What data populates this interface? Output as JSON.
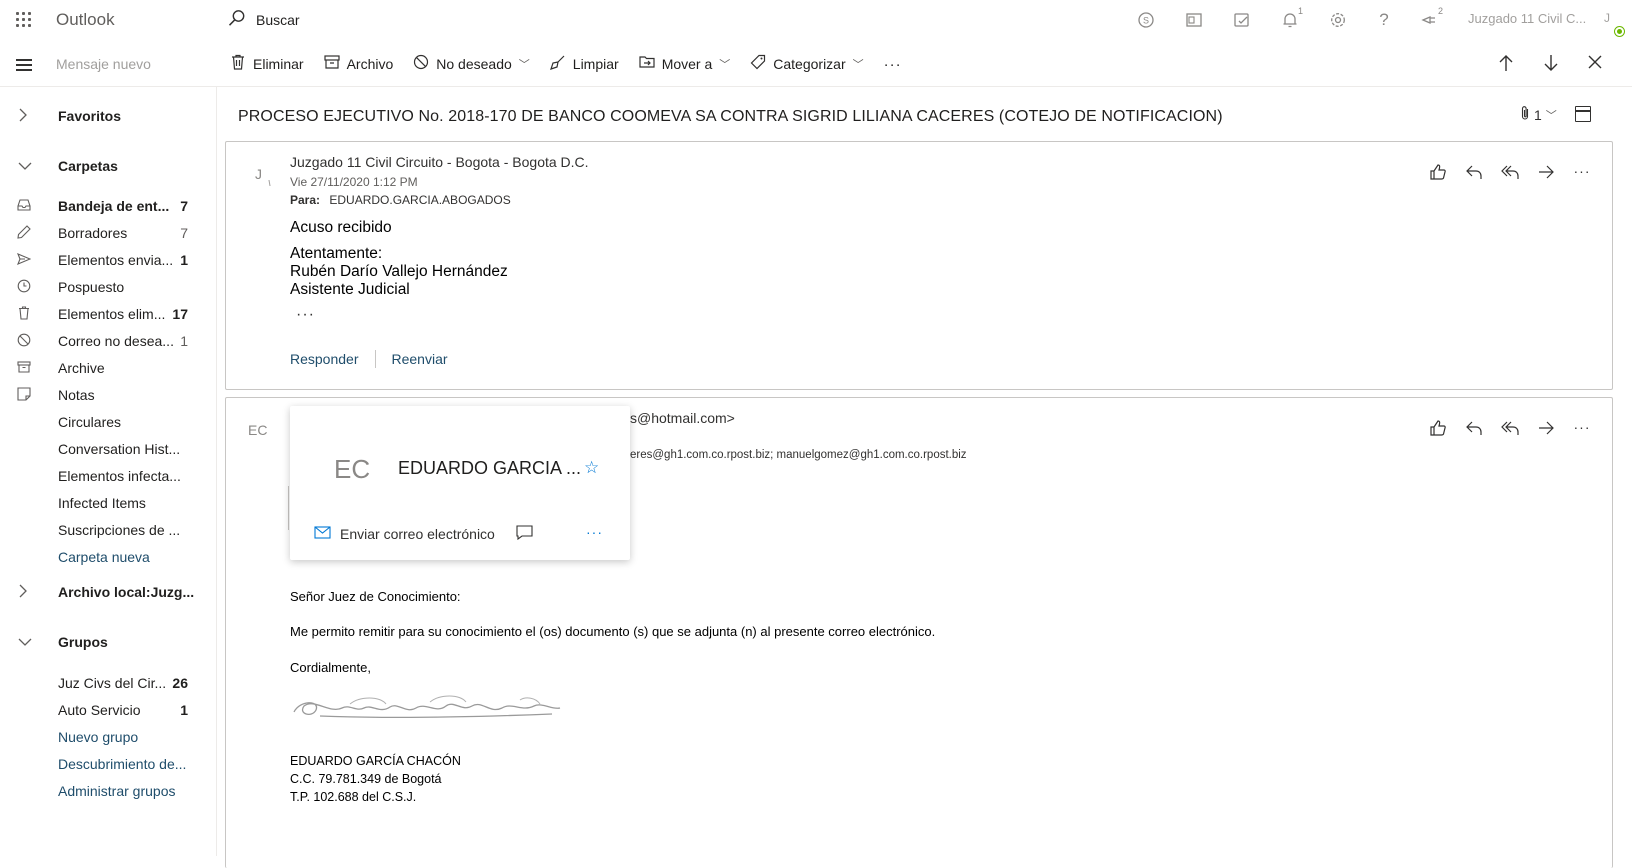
{
  "topbar": {
    "app_name": "Outlook",
    "search_text": "Buscar",
    "account_name": "Juzgado 11 Civil C...",
    "account_initial": "J",
    "notif_count_1": "1",
    "notif_count_2": "2",
    "icons": [
      "skype-icon",
      "office-icon",
      "tasks-icon",
      "bell-icon",
      "gear-icon",
      "help-icon",
      "feedback-icon"
    ]
  },
  "cmdbar": {
    "new_message": "Mensaje nuevo",
    "delete": "Eliminar",
    "archive": "Archivo",
    "junk": "No deseado",
    "sweep": "Limpiar",
    "move_to": "Mover a",
    "categorize": "Categorizar",
    "more": "···"
  },
  "left": {
    "favorites": "Favoritos",
    "folders_header": "Carpetas",
    "folders": [
      {
        "label": "Bandeja de ent...",
        "count": "7"
      },
      {
        "label": "Borradores",
        "count": "7"
      },
      {
        "label": "Elementos envia...",
        "count": "1"
      },
      {
        "label": "Pospuesto",
        "count": ""
      },
      {
        "label": "Elementos elim...",
        "count": "17"
      },
      {
        "label": "Correo no desea...",
        "count": "1"
      },
      {
        "label": "Archive",
        "count": ""
      },
      {
        "label": "Notas",
        "count": ""
      },
      {
        "label": "Circulares",
        "count": ""
      },
      {
        "label": "Conversation Hist...",
        "count": ""
      },
      {
        "label": "Elementos infecta...",
        "count": ""
      },
      {
        "label": "Infected Items",
        "count": ""
      },
      {
        "label": "Suscripciones de ...",
        "count": ""
      },
      {
        "label": "Carpeta nueva",
        "count": ""
      }
    ],
    "local_archive": "Archivo local:Juzg...",
    "groups_header": "Grupos",
    "groups": [
      {
        "label": "Juz Civs del Cir...",
        "count": "26"
      },
      {
        "label": "Auto Servicio",
        "count": "1"
      },
      {
        "label": "Nuevo grupo",
        "count": ""
      },
      {
        "label": "Descubrimiento de...",
        "count": ""
      },
      {
        "label": "Administrar grupos",
        "count": ""
      }
    ]
  },
  "reading": {
    "subject": "PROCESO EJECUTIVO No. 2018-170 DE BANCO COOMEVA SA CONTRA SIGRID LILIANA CACERES (COTEJO DE NOTIFICACION)",
    "attachment_count": "1",
    "msg1": {
      "initial": "J",
      "from": "Juzgado 11 Civil Circuito - Bogota - Bogota D.C.",
      "date": "Vie 27/11/2020 1:12 PM",
      "to_label": "Para:",
      "to": "EDUARDO.GARCIA.ABOGADOS",
      "heading": "Acuso recibido",
      "line1": "Atentamente:",
      "line2": "Rubén Darío Vallejo Hernández",
      "line3": "Asistente Judicial",
      "ellipsis": "···",
      "reply": "Responder",
      "forward": "Reenviar"
    },
    "msg2": {
      "initial": "EC",
      "from_partial": "s@hotmail.com>",
      "recipients_partial": "eres@gh1.com.co.rpost.biz; manuelgomez@gh1.com.co.rpost.biz",
      "greeting": "Señor Juez de Conocimiento:",
      "body": "Me permito remitir para su conocimiento el (os) documento (s) que se adjunta (n) al presente correo electrónico.",
      "closing": "Cordialmente,",
      "sig_name": "EDUARDO GARCÍA CHACÓN",
      "sig_id": "C.C. 79.781.349 de Bogotá",
      "sig_tp": "T.P. 102.688 del C.S.J."
    }
  },
  "persona": {
    "initials": "EC",
    "name": "EDUARDO GARCIA ...",
    "send_email": "Enviar correo electrónico",
    "more": "···"
  }
}
